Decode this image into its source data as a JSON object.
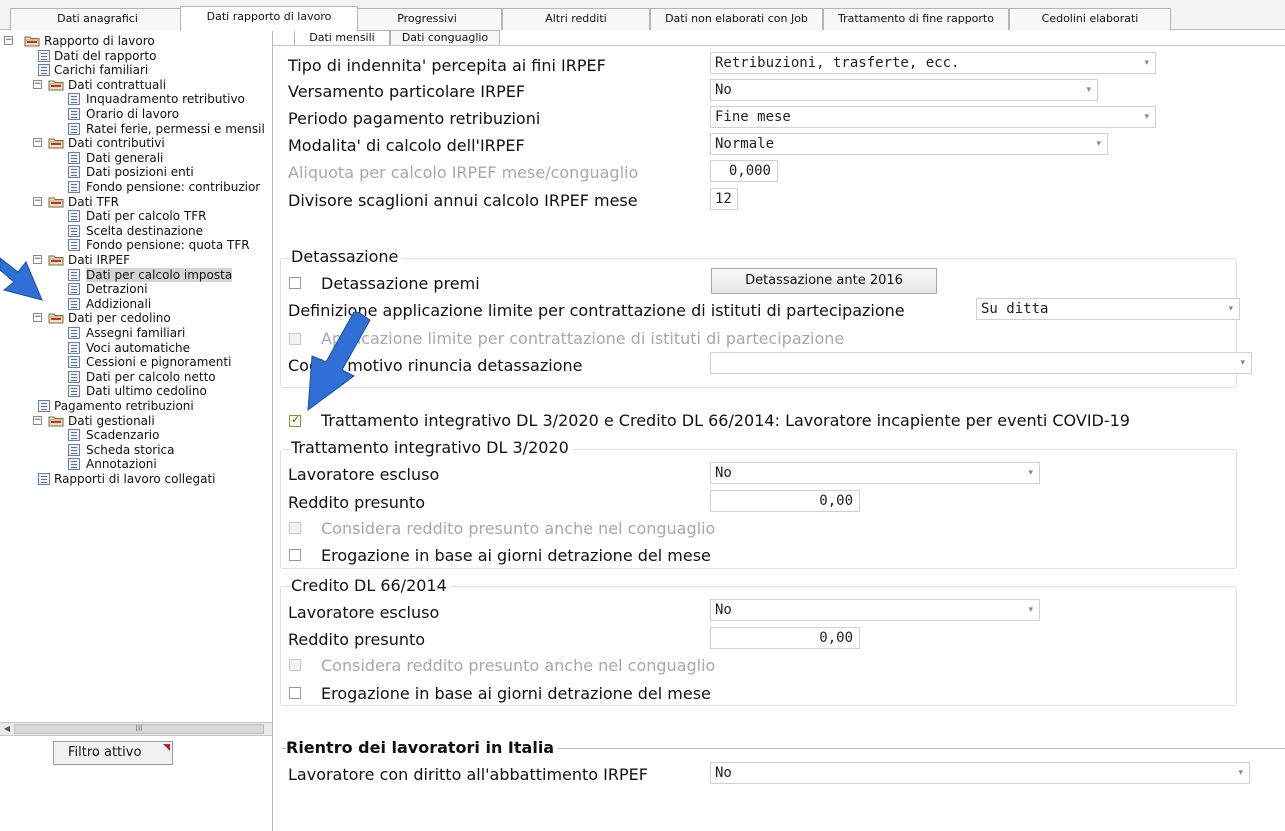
{
  "top_tabs": [
    "Dati anagrafici",
    "Dati rapporto di lavoro",
    "Progressivi",
    "Altri redditi",
    "Dati non elaborati con Job",
    "Trattamento di fine rapporto",
    "Cedolini elaborati"
  ],
  "tree": [
    {
      "label": "Rapporto di lavoro",
      "type": "folder"
    },
    {
      "label": "Dati del rapporto",
      "type": "doc"
    },
    {
      "label": "Carichi familiari",
      "type": "doc"
    },
    {
      "label": "Dati contrattuali",
      "type": "folder"
    },
    {
      "label": "Inquadramento retributivo",
      "type": "doc"
    },
    {
      "label": "Orario di lavoro",
      "type": "doc"
    },
    {
      "label": "Ratei ferie, permessi e mensil",
      "type": "doc"
    },
    {
      "label": "Dati contributivi",
      "type": "folder"
    },
    {
      "label": "Dati generali",
      "type": "doc"
    },
    {
      "label": "Dati posizioni enti",
      "type": "doc"
    },
    {
      "label": "Fondo pensione: contribuzior",
      "type": "doc"
    },
    {
      "label": "Dati TFR",
      "type": "folder"
    },
    {
      "label": "Dati per calcolo TFR",
      "type": "doc"
    },
    {
      "label": "Scelta destinazione",
      "type": "doc"
    },
    {
      "label": "Fondo pensione: quota TFR",
      "type": "doc"
    },
    {
      "label": "Dati IRPEF",
      "type": "folder"
    },
    {
      "label": "Dati per calcolo imposta",
      "type": "doc",
      "selected": true
    },
    {
      "label": "Detrazioni",
      "type": "doc"
    },
    {
      "label": "Addizionali",
      "type": "doc"
    },
    {
      "label": "Dati per cedolino",
      "type": "folder"
    },
    {
      "label": "Assegni familiari",
      "type": "doc"
    },
    {
      "label": "Voci automatiche",
      "type": "doc"
    },
    {
      "label": "Cessioni e pignoramenti",
      "type": "doc"
    },
    {
      "label": "Dati per calcolo netto",
      "type": "doc"
    },
    {
      "label": "Dati ultimo cedolino",
      "type": "doc"
    },
    {
      "label": "Pagamento retribuzioni",
      "type": "doc"
    },
    {
      "label": "Dati gestionali",
      "type": "folder"
    },
    {
      "label": "Scadenzario",
      "type": "doc"
    },
    {
      "label": "Scheda storica",
      "type": "doc"
    },
    {
      "label": "Annotazioni",
      "type": "doc"
    },
    {
      "label": "Rapporti di lavoro collegati",
      "type": "doc"
    }
  ],
  "scrollbar": {
    "grip": "III"
  },
  "filter_button": {
    "label": "Filtro attivo"
  },
  "subtabs": [
    "Dati mensili",
    "Dati conguaglio"
  ],
  "irpef": {
    "tipo_label": "Tipo di indennita' percepita ai fini IRPEF",
    "tipo_value": "Retribuzioni, trasferte, ecc.",
    "versamento_label": "Versamento particolare IRPEF",
    "versamento_value": "No",
    "periodo_label": "Periodo pagamento retribuzioni",
    "periodo_value": "Fine mese",
    "modalita_label": "Modalita' di calcolo dell'IRPEF",
    "modalita_value": "Normale",
    "aliquota_label": "Aliquota per calcolo IRPEF mese/conguaglio",
    "aliquota_value": "0,000",
    "divisore_label": "Divisore scaglioni annui calcolo IRPEF mese",
    "divisore_value": "12"
  },
  "detassazione": {
    "title": "Detassazione",
    "premi_label": "Detassazione premi",
    "ante_button": "Detassazione ante 2016",
    "definizione_label": "Definizione applicazione limite per contrattazione di istituti di partecipazione",
    "definizione_value": "Su ditta",
    "applicazione_label": "Applicazione limite per contrattazione di istituti di partecipazione",
    "motivo_label": "Codice motivo rinuncia detassazione",
    "motivo_value": ""
  },
  "covid": {
    "label": "Trattamento integrativo DL 3/2020 e Credito DL 66/2014: Lavoratore incapiente per eventi COVID-19",
    "checked": true
  },
  "trattamento": {
    "title": "Trattamento integrativo DL 3/2020",
    "escluso_label": "Lavoratore escluso",
    "escluso_value": "No",
    "reddito_label": "Reddito presunto",
    "reddito_value": "0,00",
    "considera_label": "Considera reddito presunto anche nel conguaglio",
    "erogazione_label": "Erogazione in base ai giorni detrazione del mese"
  },
  "credito": {
    "title": "Credito DL 66/2014",
    "escluso_label": "Lavoratore escluso",
    "escluso_value": "No",
    "reddito_label": "Reddito presunto",
    "reddito_value": "0,00",
    "considera_label": "Considera reddito presunto anche nel conguaglio",
    "erogazione_label": "Erogazione in base ai giorni detrazione del mese"
  },
  "rientro": {
    "title": "Rientro dei lavoratori in Italia",
    "abbattimento_label": "Lavoratore con diritto all'abbattimento IRPEF",
    "abbattimento_value": "No"
  },
  "colors": {
    "arrow": "#2f6fd6",
    "arrow_border": "#1b4fa8",
    "selected_bg": "#d4d4d4",
    "checkbox_check": "#4a6a0a",
    "filter_marker": "#c0202a"
  }
}
